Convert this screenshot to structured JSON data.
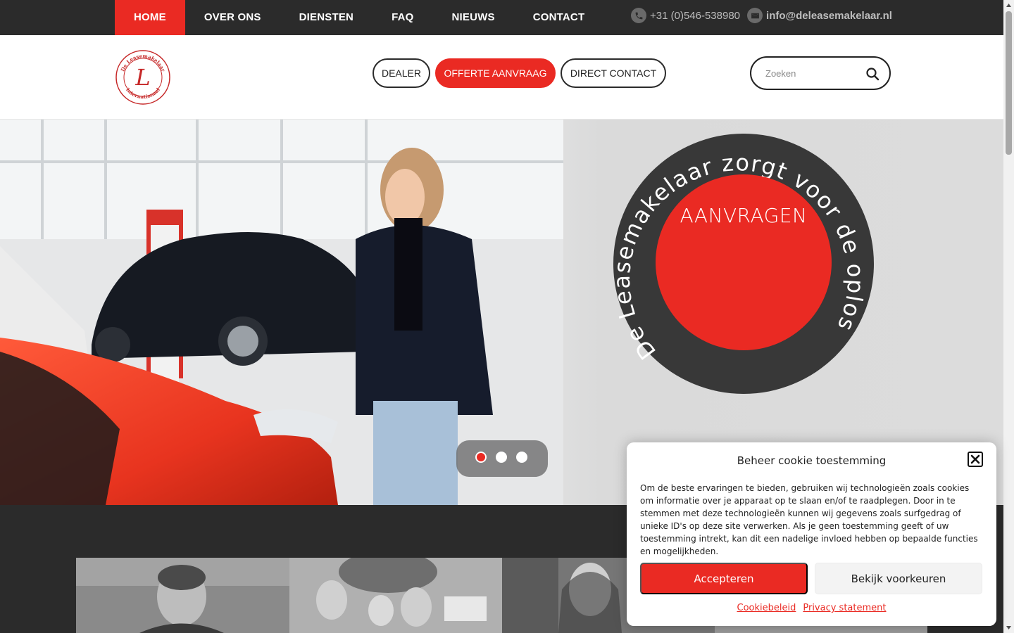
{
  "topbar": {
    "nav": [
      {
        "label": "HOME"
      },
      {
        "label": "OVER ONS"
      },
      {
        "label": "DIENSTEN"
      },
      {
        "label": "FAQ"
      },
      {
        "label": "NIEUWS"
      },
      {
        "label": "CONTACT"
      }
    ],
    "phone": "+31 (0)546-538980",
    "email": "info@deleasemakelaar.nl",
    "phone_icon": "phone-icon",
    "email_icon": "envelope-icon"
  },
  "header": {
    "logo": {
      "top_text": "De Leasemakelaar",
      "monogram": "L",
      "bottom_text": "Internationaal"
    },
    "buttons": {
      "dealer": "DEALER",
      "offerte": "OFFERTE AANVRAAG",
      "direct": "DIRECT CONTACT"
    },
    "search": {
      "placeholder": "Zoeken",
      "value": ""
    }
  },
  "hero": {
    "badge_ring_text": "De Leasemakelaar zorgt voor de oplossing",
    "badge_button": "AANVRAGEN",
    "slides": 3,
    "active_slide": 1
  },
  "cookie": {
    "title": "Beheer cookie toestemming",
    "text": "Om de beste ervaringen te bieden, gebruiken wij technologieën zoals cookies om informatie over je apparaat op te slaan en/of te raadplegen. Door in te stemmen met deze technologieën kunnen wij gegevens zoals surfgedrag of unieke ID's op deze site verwerken. Als je geen toestemming geeft of uw toestemming intrekt, kan dit een nadelige invloed hebben op bepaalde functies en mogelijkheden.",
    "accept": "Accepteren",
    "preferences": "Bekijk voorkeuren",
    "links": [
      "Cookiebeleid",
      "Privacy statement"
    ]
  },
  "colors": {
    "accent": "#ea2a23",
    "dark": "#2b2b2b"
  }
}
